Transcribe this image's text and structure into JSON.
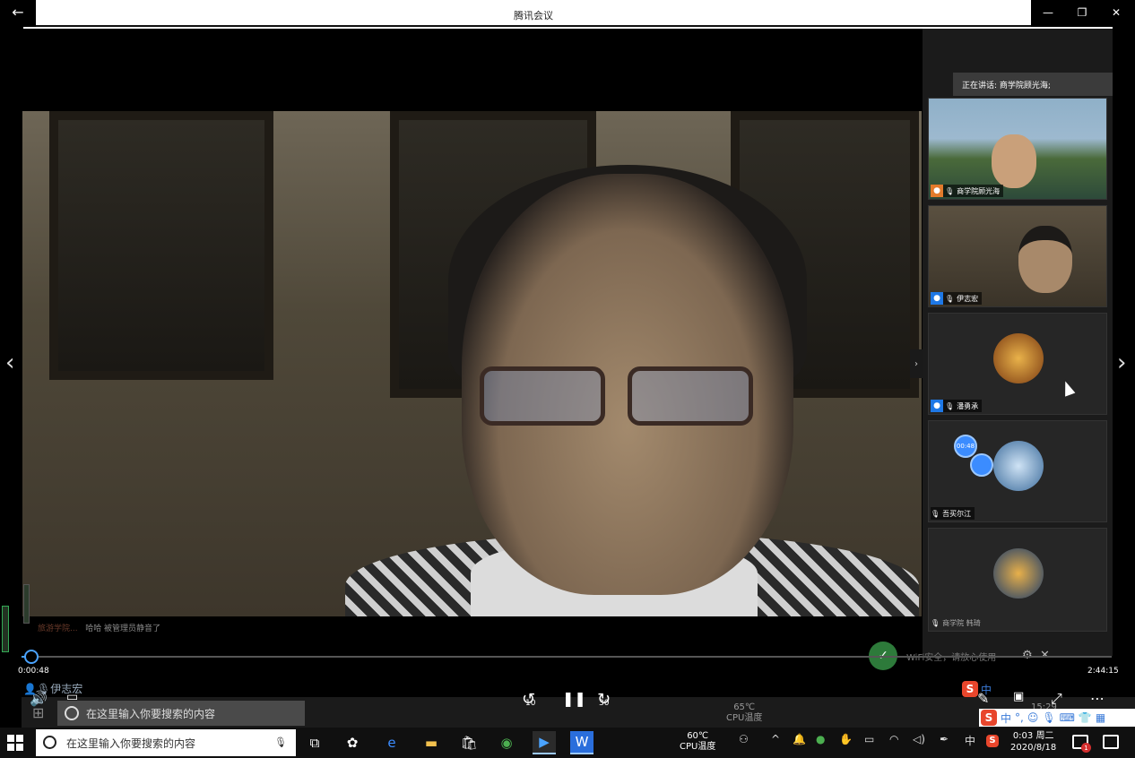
{
  "window": {
    "title": "腾讯会议"
  },
  "speaker_banner": {
    "text": "正在讲话: 商学院顾光海;"
  },
  "participants": [
    {
      "name": "商学院顾光海",
      "icon_color": "#e37b2c"
    },
    {
      "name": "伊志宏",
      "icon_color": "#1e78e6"
    },
    {
      "name": "潘勇承",
      "icon_color": "#1e78e6"
    },
    {
      "name": "吾买尔江",
      "timer": "00:48"
    },
    {
      "name": "商学院 韩琦"
    }
  ],
  "chat": {
    "sender": "旅游学院...",
    "message": "哈哈 被管理员静音了"
  },
  "playback": {
    "current_time": "0:00:48",
    "total_time": "2:44:15",
    "skip_back": "10",
    "skip_forward": "30",
    "progress_fraction": 0.005
  },
  "wifi": {
    "message": "WiFi安全，请放心使用"
  },
  "overlay_name": "伊志宏",
  "recorded_taskbar": {
    "search_placeholder": "在这里输入你要搜索的内容",
    "cpu_temp": "65℃",
    "cpu_label": "CPU温度",
    "clock_time": "15:29"
  },
  "taskbar": {
    "search_placeholder": "在这里输入你要搜索的内容",
    "cpu_temp": "60℃",
    "cpu_label": "CPU温度",
    "ime_lang": "中",
    "clock_time": "0:03 周二",
    "clock_date": "2020/8/18",
    "notification_count": "1"
  },
  "ime_toolbar": {
    "lang": "中",
    "punct": "°,"
  },
  "colors": {
    "accent": "#4aa3ff",
    "wifi_green": "#2d7a3a",
    "sogou_red": "#e8462c"
  }
}
